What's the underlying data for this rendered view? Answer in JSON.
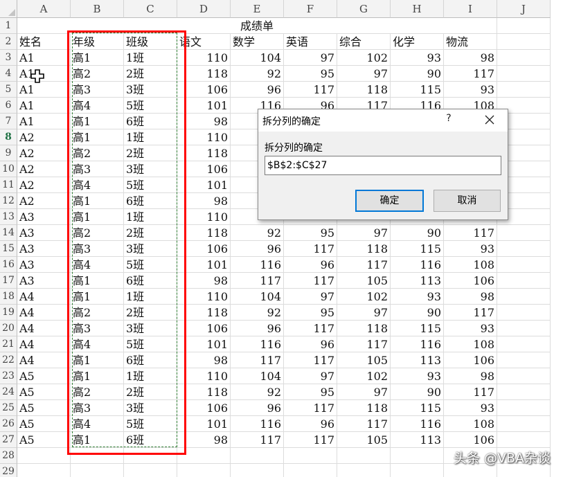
{
  "spreadsheet": {
    "column_headers": [
      "A",
      "B",
      "C",
      "D",
      "E",
      "F",
      "G",
      "H",
      "I",
      "J"
    ],
    "row_numbers": [
      "1",
      "2",
      "3",
      "4",
      "5",
      "6",
      "7",
      "8",
      "9",
      "10",
      "11",
      "12",
      "13",
      "14",
      "15",
      "16",
      "17",
      "18",
      "19",
      "20",
      "21",
      "22",
      "23",
      "24",
      "25",
      "26",
      "27",
      "28",
      "29"
    ],
    "active_row": "8",
    "title_cell": "成绩单",
    "header_row": [
      "姓名",
      "年级",
      "班级",
      "语文",
      "数学",
      "英语",
      "综合",
      "化学",
      "物流"
    ],
    "rows": [
      [
        "A1",
        "高1",
        "1班",
        "110",
        "104",
        "97",
        "102",
        "93",
        "98"
      ],
      [
        "A1",
        "高2",
        "2班",
        "118",
        "92",
        "95",
        "97",
        "90",
        "117"
      ],
      [
        "A1",
        "高3",
        "3班",
        "106",
        "96",
        "117",
        "118",
        "115",
        "93"
      ],
      [
        "A1",
        "高4",
        "5班",
        "101",
        "116",
        "96",
        "117",
        "116",
        "108"
      ],
      [
        "A1",
        "高1",
        "6班",
        "98",
        "",
        "",
        "",
        "",
        ""
      ],
      [
        "A2",
        "高1",
        "1班",
        "110",
        "",
        "",
        "",
        "",
        ""
      ],
      [
        "A2",
        "高2",
        "2班",
        "118",
        "",
        "",
        "",
        "",
        ""
      ],
      [
        "A2",
        "高3",
        "3班",
        "106",
        "",
        "",
        "",
        "",
        ""
      ],
      [
        "A2",
        "高4",
        "5班",
        "101",
        "",
        "",
        "",
        "",
        ""
      ],
      [
        "A2",
        "高1",
        "6班",
        "98",
        "",
        "",
        "",
        "",
        ""
      ],
      [
        "A3",
        "高1",
        "1班",
        "110",
        "",
        "",
        "",
        "",
        ""
      ],
      [
        "A3",
        "高2",
        "2班",
        "118",
        "92",
        "95",
        "97",
        "90",
        "117"
      ],
      [
        "A3",
        "高3",
        "3班",
        "106",
        "96",
        "117",
        "118",
        "115",
        "93"
      ],
      [
        "A3",
        "高4",
        "5班",
        "101",
        "116",
        "96",
        "117",
        "116",
        "108"
      ],
      [
        "A3",
        "高1",
        "6班",
        "98",
        "117",
        "117",
        "105",
        "113",
        "106"
      ],
      [
        "A4",
        "高1",
        "1班",
        "110",
        "104",
        "97",
        "102",
        "93",
        "98"
      ],
      [
        "A4",
        "高2",
        "2班",
        "118",
        "92",
        "95",
        "97",
        "90",
        "117"
      ],
      [
        "A4",
        "高3",
        "3班",
        "106",
        "96",
        "117",
        "118",
        "115",
        "93"
      ],
      [
        "A4",
        "高4",
        "5班",
        "101",
        "116",
        "96",
        "117",
        "116",
        "108"
      ],
      [
        "A4",
        "高1",
        "6班",
        "98",
        "117",
        "117",
        "105",
        "113",
        "106"
      ],
      [
        "A5",
        "高1",
        "1班",
        "110",
        "104",
        "97",
        "102",
        "93",
        "98"
      ],
      [
        "A5",
        "高2",
        "2班",
        "118",
        "92",
        "95",
        "97",
        "90",
        "117"
      ],
      [
        "A5",
        "高3",
        "3班",
        "106",
        "96",
        "117",
        "118",
        "115",
        "93"
      ],
      [
        "A5",
        "高4",
        "5班",
        "101",
        "116",
        "96",
        "117",
        "116",
        "108"
      ],
      [
        "A5",
        "高1",
        "6班",
        "98",
        "117",
        "117",
        "105",
        "113",
        "106"
      ]
    ],
    "highlight_color": "#ff0000",
    "marching_ants_color": "#2e7d32"
  },
  "dialog": {
    "title": "拆分列的确定",
    "help_label": "?",
    "prompt_label": "拆分列的确定",
    "input_value": "$B$2:$C$27",
    "ok_label": "确定",
    "cancel_label": "取消",
    "accent_color": "#0078d7"
  },
  "watermark": "头条 @VBA杂谈"
}
